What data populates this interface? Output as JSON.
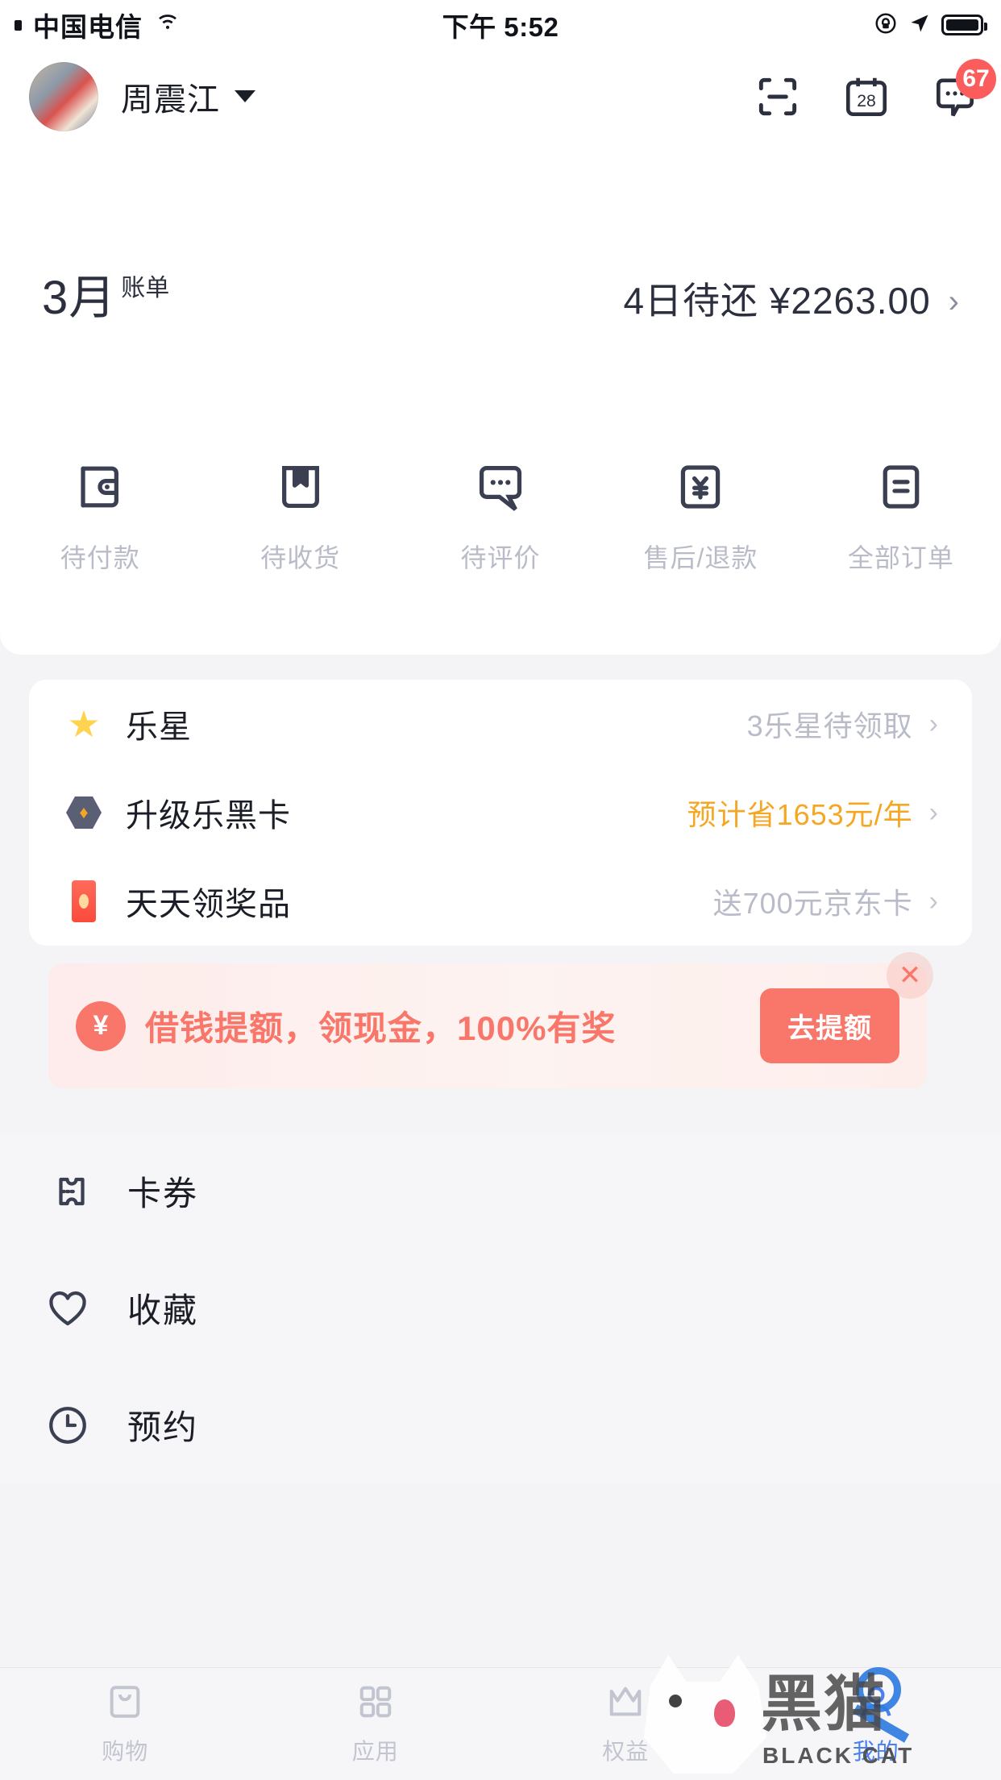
{
  "status_bar": {
    "carrier": "中国电信",
    "wifi_icon": "wifi-icon",
    "time": "下午 5:52",
    "lock_icon": "rotation-lock-icon",
    "location_icon": "location-arrow-icon",
    "battery_icon": "battery-full-icon"
  },
  "header": {
    "avatar": "user-avatar",
    "username": "周震江",
    "dropdown_icon": "caret-down-icon",
    "scan_icon": "scan-icon",
    "calendar_icon": "calendar-icon",
    "calendar_day": "28",
    "message_icon": "message-icon",
    "message_badge": "67"
  },
  "bill": {
    "month": "3月",
    "label": "账单",
    "due": "4日待还 ¥2263.00",
    "arrow": "›"
  },
  "orders": [
    {
      "icon": "wallet-icon",
      "label": "待付款"
    },
    {
      "icon": "package-icon",
      "label": "待收货"
    },
    {
      "icon": "comment-icon",
      "label": "待评价"
    },
    {
      "icon": "refund-icon",
      "label": "售后/退款"
    },
    {
      "icon": "list-icon",
      "label": "全部订单"
    }
  ],
  "benefits": [
    {
      "icon": "star-icon",
      "label": "乐星",
      "value": "3乐星待领取",
      "highlight": false,
      "arrow": "›"
    },
    {
      "icon": "gem-icon",
      "label": "升级乐黑卡",
      "value": "预计省1653元/年",
      "highlight": true,
      "arrow": "›"
    },
    {
      "icon": "redtag-icon",
      "label": "天天领奖品",
      "value": "送700元京东卡",
      "highlight": false,
      "arrow": "›"
    }
  ],
  "promo": {
    "icon": "yuan-coin-icon",
    "icon_text": "¥",
    "text": "借钱提额，领现金，100%有奖",
    "button": "去提额",
    "close_icon": "close-icon",
    "close_text": "✕"
  },
  "menu": [
    {
      "icon": "ticket-icon",
      "label": "卡券"
    },
    {
      "icon": "heart-icon",
      "label": "收藏"
    },
    {
      "icon": "clock-icon",
      "label": "预约"
    }
  ],
  "tabbar": [
    {
      "icon": "shopping-bag-icon",
      "label": "购物",
      "active": false
    },
    {
      "icon": "apps-grid-icon",
      "label": "应用",
      "active": false
    },
    {
      "icon": "crown-icon",
      "label": "权益",
      "active": false
    },
    {
      "icon": "profile-icon",
      "label": "我的",
      "active": true
    }
  ],
  "watermark": {
    "title": "黑猫",
    "subtitle": "BLACK CAT"
  },
  "colors": {
    "accent_orange": "#f5a623",
    "promo_red": "#f8776a",
    "badge_red": "#fb5d5d",
    "text_dark": "#1b1d27",
    "text_muted": "#b9bcc8",
    "tab_active": "#4a7ff0",
    "background": "#f4f4f6"
  }
}
